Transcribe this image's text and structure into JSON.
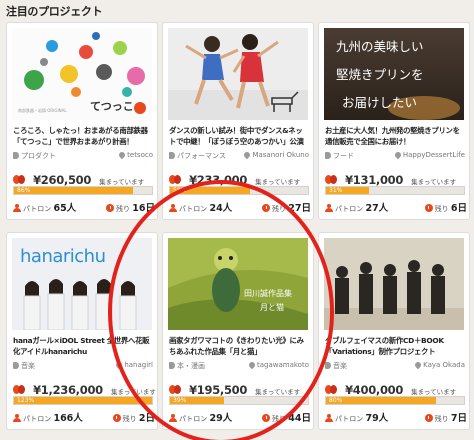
{
  "section": {
    "title": "注目のプロジェクト"
  },
  "projects": [
    {
      "title": "ころころ、しゃたっ！おまあがる南部鉄器「てつっこ」で世界おまあがり計画！",
      "category": "プロダクト",
      "owner": "tetsoco",
      "amount": "¥260,500",
      "amount_label": "集まっています",
      "percent_text": "86%",
      "percent": 86,
      "patron_label": "パトロン",
      "patrons": "65人",
      "remain_label": "残り",
      "remain": "16日",
      "thumb_text": "てつっこ",
      "thumb_subtext": "南部鉄器・岩鋳 ORIGINAL"
    },
    {
      "title": "ダンスの新しい試み！街中でダンス&ネットで中継！「ぼうぼう空のあつかい」公演",
      "category": "パフォーマンス",
      "owner": "Masanori Okuno",
      "amount": "¥233,000",
      "amount_label": "集まっています",
      "percent_text": "58%",
      "percent": 58,
      "patron_label": "パトロン",
      "patrons": "24人",
      "remain_label": "残り",
      "remain": "27日"
    },
    {
      "title": "お土産に大人気！九州発の堅焼きプリンを通信販売で全国にお届け！",
      "category": "フード",
      "owner": "HappyDessertLife",
      "amount": "¥131,000",
      "amount_label": "集まっています",
      "percent_text": "31%",
      "percent": 31,
      "patron_label": "パトロン",
      "patrons": "27人",
      "remain_label": "残り",
      "remain": "6日",
      "thumb_lines": [
        "九州の美味しい",
        "堅焼きプリンを",
        "お届けしたい"
      ]
    },
    {
      "title": "hanaガール×iDOL Street 全世界へ花販化アイドルhanarichu",
      "category": "音楽",
      "owner": "hanagirl",
      "amount": "¥1,236,000",
      "amount_label": "集まっています",
      "percent_text": "123%",
      "percent": 100,
      "patron_label": "パトロン",
      "patrons": "166人",
      "remain_label": "残り",
      "remain": "2日",
      "thumb_text": "hanarichu"
    },
    {
      "title": "画家タガワマコトの《きわりたい光》にみちあふれた作品集「月と猫」",
      "category": "本・漫画",
      "owner": "tagawamakoto",
      "amount": "¥195,500",
      "amount_label": "集まっています",
      "percent_text": "39%",
      "percent": 39,
      "patron_label": "パトロン",
      "patrons": "29人",
      "remain_label": "残り",
      "remain": "44日",
      "thumb_lines": [
        "田川誠作品集",
        "月と猫"
      ]
    },
    {
      "title": "ダブルフェイマスの新作CD＋BOOK「Variations」制作プロジェクト",
      "category": "音楽",
      "owner": "Kaya Okada",
      "amount": "¥400,000",
      "amount_label": "集まっています",
      "percent_text": "80%",
      "percent": 80,
      "patron_label": "パトロン",
      "patrons": "79人",
      "remain_label": "残り",
      "remain": "7日"
    }
  ],
  "colors": {
    "accent": "#e8481b",
    "progress": "#f5a623",
    "highlight_circle": "#e3231b",
    "background": "#f1eee9"
  }
}
